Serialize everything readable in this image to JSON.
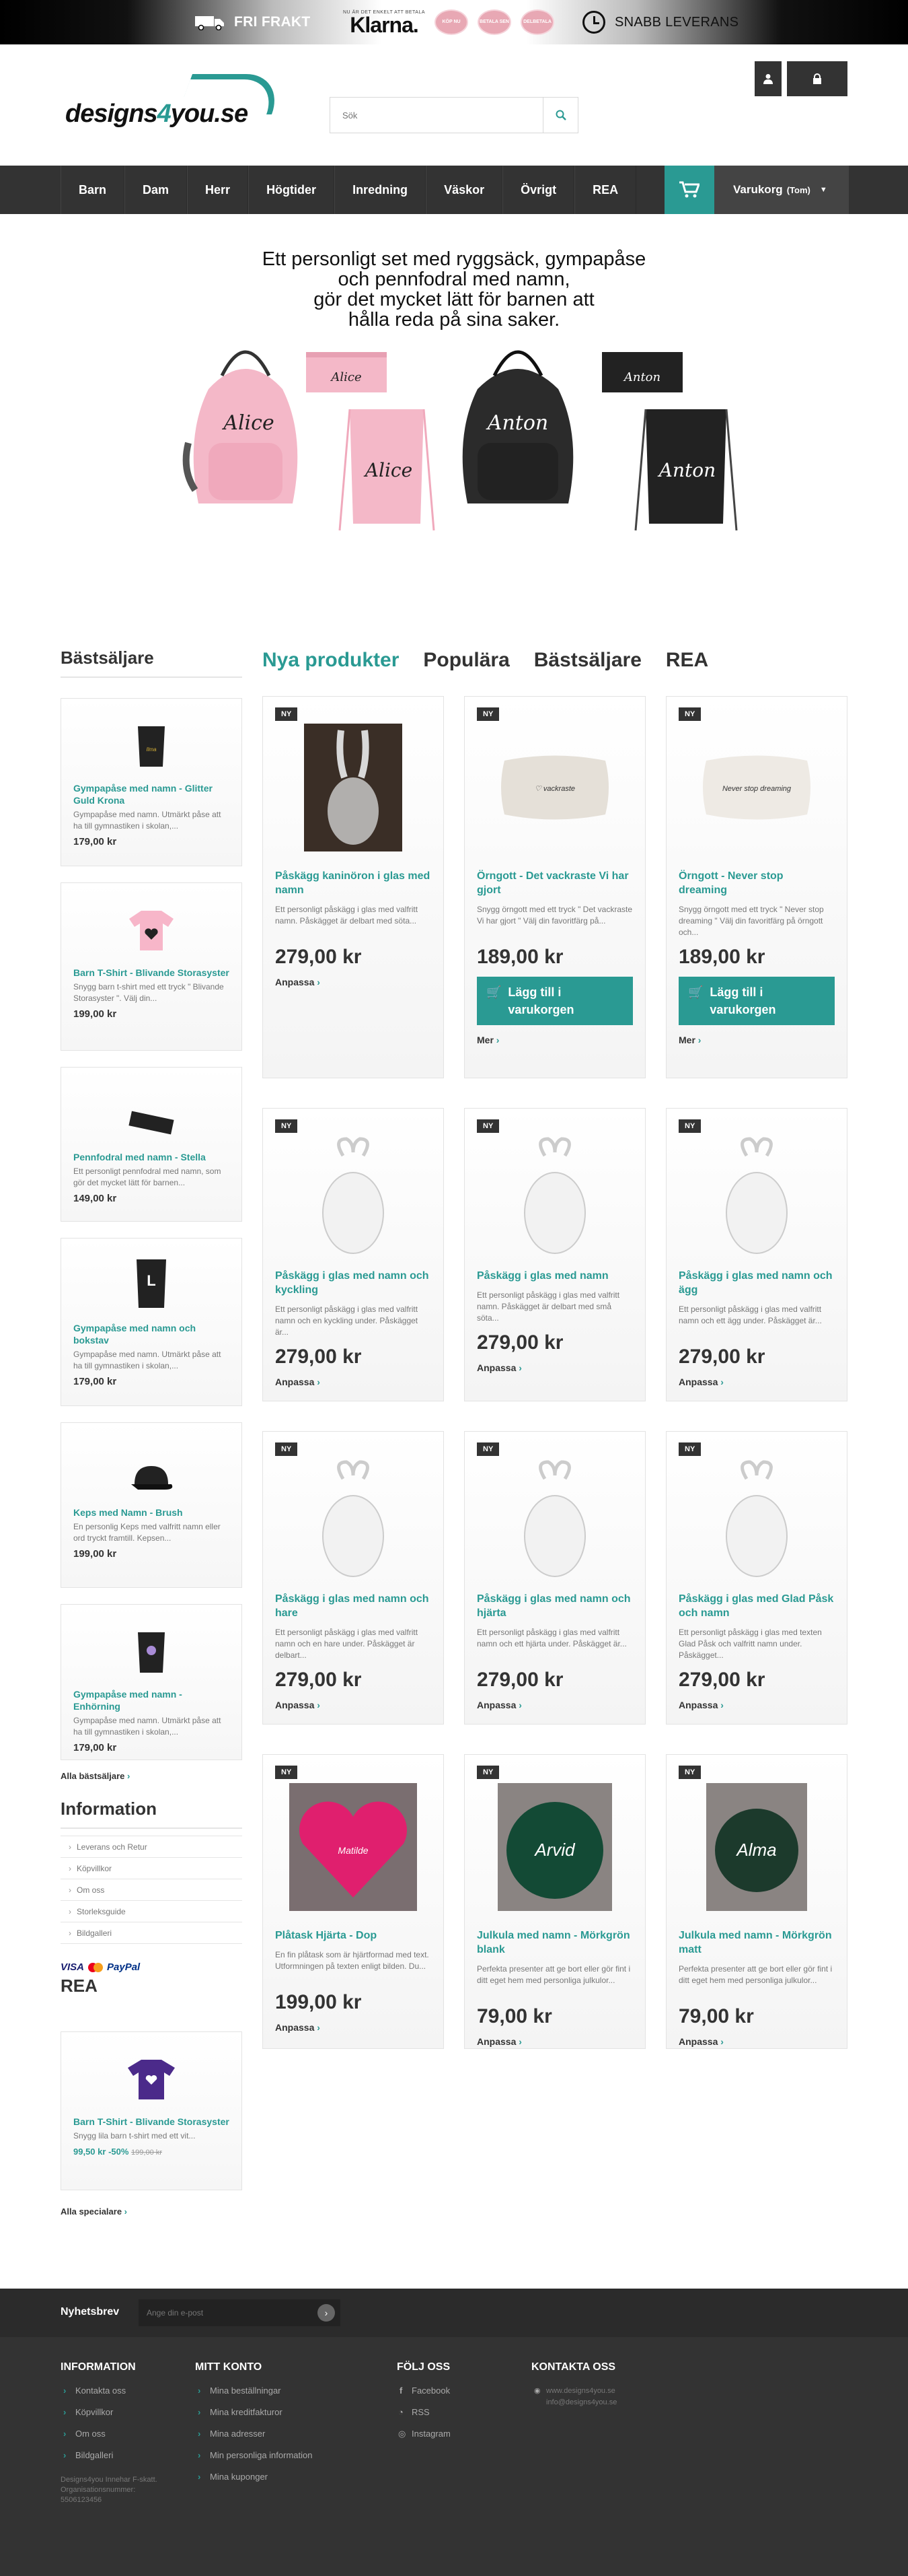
{
  "topbar": {
    "free_shipping": "FRI FRAKT",
    "klarna_small": "NU ÄR DET ENKELT ATT BETALA",
    "klarna": "Klarna.",
    "pills": [
      "KÖP NU",
      "BETALA SEN",
      "DELBETALA"
    ],
    "fast_delivery": "SNABB LEVERANS"
  },
  "header": {
    "logo_main": "designs",
    "logo_num": "4",
    "logo_tail": "you.se",
    "search_placeholder": "Sök"
  },
  "nav": {
    "items": [
      "Barn",
      "Dam",
      "Herr",
      "Högtider",
      "Inredning",
      "Väskor",
      "Övrigt",
      "REA"
    ],
    "cart_label": "Varukorg",
    "cart_status": "(Tom)"
  },
  "banner": {
    "line1": "Ett personligt set med ryggsäck, gympapåse",
    "line2": "och pennfodral med namn,",
    "line3": "gör det mycket lätt för barnen att",
    "line4": "hålla reda på sina saker.",
    "name_pink": "Alice",
    "name_black": "Anton"
  },
  "sidebar": {
    "heading": "Bästsäljare",
    "items": [
      {
        "title": "Gympapåse med namn - Glitter Guld Krona",
        "desc": "Gympapåse med namn. Utmärkt påse att ha till gymnastiken i skolan,...",
        "price": "179,00 kr"
      },
      {
        "title": "Barn T-Shirt - Blivande Storasyster",
        "desc": "Snygg barn t-shirt med ett tryck \" Blivande Storasyster \". Välj din...",
        "price": "199,00 kr"
      },
      {
        "title": "Pennfodral med namn - Stella",
        "desc": "Ett personligt pennfodral med namn, som gör det mycket lätt för barnen...",
        "price": "149,00 kr"
      },
      {
        "title": "Gympapåse med namn och bokstav",
        "desc": "Gympapåse med namn. Utmärkt påse att ha till gymnastiken i skolan,...",
        "price": "179,00 kr"
      },
      {
        "title": "Keps med Namn - Brush",
        "desc": "En personlig Keps med valfritt namn eller ord tryckt framtill. Kepsen...",
        "price": "199,00 kr"
      },
      {
        "title": "Gympapåse med namn - Enhörning",
        "desc": "Gympapåse med namn. Utmärkt påse att ha till gymnastiken i skolan,...",
        "price": "179,00 kr"
      }
    ],
    "all_link": "Alla bästsäljare",
    "info_heading": "Information",
    "info_links": [
      "Leverans och Retur",
      "Köpvillkor",
      "Om oss",
      "Storleksguide",
      "Bildgalleri"
    ],
    "pay": [
      "VISA",
      "PayPal"
    ],
    "rea_heading": "REA",
    "rea_item": {
      "title": "Barn T-Shirt - Blivande Storasyster",
      "desc": "Snygg lila barn t-shirt med ett vit...",
      "price": "99,50 kr",
      "discount": "-50%",
      "old_price": "199,00 kr"
    },
    "rea_all": "Alla specialare"
  },
  "tabs": [
    "Nya produkter",
    "Populära",
    "Bästsäljare",
    "REA"
  ],
  "products": [
    {
      "badge": "NY",
      "title": "Påskägg kaninöron i glas med namn",
      "desc": "Ett personligt påskägg i glas med valfritt namn. Påskägget är delbart med söta...",
      "price": "279,00 kr",
      "action": "Anpassa"
    },
    {
      "badge": "NY",
      "title": "Örngott - Det vackraste Vi har gjort",
      "desc": "Snygg örngott med ett tryck \" Det vackraste Vi har gjort \" Välj din favoritfärg på...",
      "price": "189,00 kr",
      "add": "Lägg till i varukorgen",
      "action": "Mer"
    },
    {
      "badge": "NY",
      "title": "Örngott - Never stop dreaming",
      "desc": "Snygg örngott med ett tryck \" Never stop dreaming \" Välj din favoritfärg på örngott och...",
      "price": "189,00 kr",
      "add": "Lägg till i varukorgen",
      "action": "Mer"
    },
    {
      "badge": "NY",
      "title": "Påskägg i glas med namn och kyckling",
      "desc": "Ett personligt påskägg i glas med valfritt namn och en kyckling under. Påskägget är...",
      "price": "279,00 kr",
      "action": "Anpassa"
    },
    {
      "badge": "NY",
      "title": "Påskägg i glas med namn",
      "desc": "Ett personligt påskägg i glas med valfritt namn. Påskägget är delbart med små söta...",
      "price": "279,00 kr",
      "action": "Anpassa"
    },
    {
      "badge": "NY",
      "title": "Påskägg i glas med namn och ägg",
      "desc": "Ett personligt påskägg i glas med valfritt namn och ett ägg under. Påskägget är...",
      "price": "279,00 kr",
      "action": "Anpassa"
    },
    {
      "badge": "NY",
      "title": "Påskägg i glas med namn och hare",
      "desc": "Ett personligt påskägg i glas med valfritt namn och en hare under. Påskägget är delbart...",
      "price": "279,00 kr",
      "action": "Anpassa"
    },
    {
      "badge": "NY",
      "title": "Påskägg i glas med namn och hjärta",
      "desc": "Ett personligt påskägg i glas med valfritt namn och ett hjärta under. Påskägget är...",
      "price": "279,00 kr",
      "action": "Anpassa"
    },
    {
      "badge": "NY",
      "title": "Påskägg i glas med Glad Påsk och namn",
      "desc": "Ett personligt påskägg i glas med texten Glad Påsk och valfritt namn under. Påskägget...",
      "price": "279,00 kr",
      "action": "Anpassa"
    },
    {
      "badge": "NY",
      "title": "Plåtask Hjärta - Dop",
      "desc": "En fin plåtask som är hjärtformad med text. Utformningen på texten enligt bilden. Du...",
      "price": "199,00 kr",
      "action": "Anpassa"
    },
    {
      "badge": "NY",
      "title": "Julkula med namn - Mörkgrön blank",
      "desc": "Perfekta presenter att ge bort eller gör fint i ditt eget hem med personliga julkulor...",
      "price": "79,00 kr",
      "action": "Anpassa"
    },
    {
      "badge": "NY",
      "title": "Julkula med namn - Mörkgrön matt",
      "desc": "Perfekta presenter att ge bort eller gör fint i ditt eget hem med personliga julkulor...",
      "price": "79,00 kr",
      "action": "Anpassa"
    }
  ],
  "newsletter": {
    "label": "Nyhetsbrev",
    "placeholder": "Ange din e-post"
  },
  "footer": {
    "info": {
      "heading": "INFORMATION",
      "links": [
        "Kontakta oss",
        "Köpvillkor",
        "Om oss",
        "Bildgalleri"
      ],
      "company": "Designs4you Innehar F-skatt.",
      "company2": "Organisationsnummer:",
      "orgnr": "5506123456"
    },
    "account": {
      "heading": "MITT KONTO",
      "links": [
        "Mina beställningar",
        "Mina kreditfakturor",
        "Mina adresser",
        "Min personliga information",
        "Mina kuponger"
      ]
    },
    "follow": {
      "heading": "FÖLJ OSS",
      "links": [
        "Facebook",
        "RSS",
        "Instagram"
      ]
    },
    "contact": {
      "heading": "KONTAKTA OSS",
      "site": "www.designs4you.se",
      "email": "info@designs4you.se"
    }
  },
  "colors": {
    "accent": "#2a9a93",
    "dark": "#333333"
  }
}
